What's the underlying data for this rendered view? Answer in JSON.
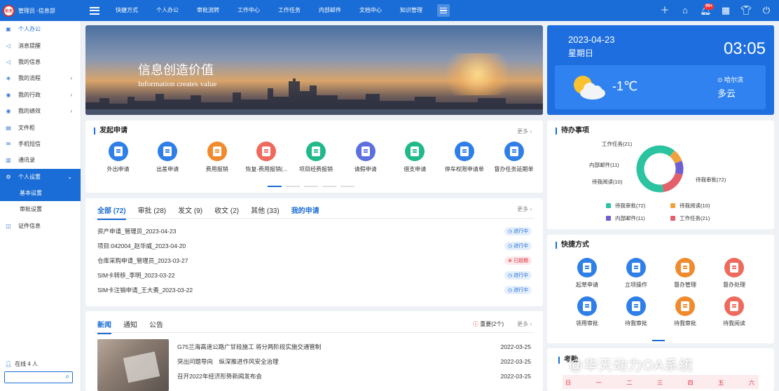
{
  "topbar": {
    "logo_text": "华天",
    "user": "管理员 -信息部",
    "nav": [
      "快捷方式",
      "个人办公",
      "审批流转",
      "工作中心",
      "工作任务",
      "内部邮件",
      "文档中心",
      "知识管理"
    ],
    "badge": "99+"
  },
  "sidebar": {
    "items": [
      {
        "label": "个人办公",
        "icon": "book-icon"
      },
      {
        "label": "消息提醒",
        "icon": "speaker-icon"
      },
      {
        "label": "我的信息",
        "icon": "speaker-icon"
      },
      {
        "label": "我的流程",
        "icon": "flow-icon",
        "chevron": "›"
      },
      {
        "label": "我的行政",
        "icon": "admin-icon",
        "chevron": "›"
      },
      {
        "label": "我的绩效",
        "icon": "performance-icon",
        "chevron": "›"
      },
      {
        "label": "文件柜",
        "icon": "cabinet-icon"
      },
      {
        "label": "手机短信",
        "icon": "mail-icon"
      },
      {
        "label": "通讯录",
        "icon": "contacts-icon"
      },
      {
        "label": "个人设置",
        "icon": "gear-icon",
        "chevron": "⌄"
      },
      {
        "label": "基本设置",
        "icon": ""
      },
      {
        "label": "审批设置",
        "icon": ""
      },
      {
        "label": "证件信息",
        "icon": "certificate-icon"
      }
    ],
    "online": "在线 4 人",
    "search_placeholder": ""
  },
  "banner": {
    "title": "信息创造价值",
    "subtitle": "Information creates value"
  },
  "weather": {
    "date": "2023-04-23",
    "weekday": "星期日",
    "time": "03:05",
    "temp": "-1℃",
    "city": "哈尔滨",
    "condition": "多云"
  },
  "apply": {
    "title": "发起申请",
    "more": "更多 ›",
    "apps": [
      {
        "label": "外出申请",
        "color": "#2f7fe8"
      },
      {
        "label": "出差申请",
        "color": "#2f7fe8"
      },
      {
        "label": "费用报销",
        "color": "#f08a2c"
      },
      {
        "label": "恢复-费用报销(...",
        "color": "#ee6a5c"
      },
      {
        "label": "项目经费报销",
        "color": "#20b98a"
      },
      {
        "label": "请假申请",
        "color": "#5d6fe0"
      },
      {
        "label": "借支申请",
        "color": "#20b98a"
      },
      {
        "label": "停车权限申请单",
        "color": "#2f7fe8"
      },
      {
        "label": "督办任务延期单",
        "color": "#2f7fe8"
      }
    ]
  },
  "requests": {
    "tabs": [
      "全部 (72)",
      "审批 (28)",
      "发文 (9)",
      "收文 (2)",
      "其他 (33)",
      "我的申请"
    ],
    "more": "更多 ›",
    "rows": [
      {
        "text": "资产申请_管理员_2023-04-23",
        "status": "进行中",
        "kind": "run"
      },
      {
        "text": "项目:042004_赵华威_2023-04-20",
        "status": "进行中",
        "kind": "run"
      },
      {
        "text": "仓库采购申请_管理员_2023-03-27",
        "status": "已超期",
        "kind": "late"
      },
      {
        "text": "SIM卡转移_李明_2023-03-22",
        "status": "进行中",
        "kind": "run"
      },
      {
        "text": "SIM卡注销申请_王大勇_2023-03-22",
        "status": "进行中",
        "kind": "run"
      }
    ]
  },
  "news": {
    "tabs": [
      "新闻",
      "通知",
      "公告"
    ],
    "important": "重要(2个)",
    "more": "更多 ›",
    "rows": [
      {
        "title": "G75兰海高速公路广甘段施工 将分两阶段实施交通管制",
        "date": "2022-03-25"
      },
      {
        "title": "突出问题导向　纵深推进作风安全治理",
        "date": "2022-03-25"
      },
      {
        "title": "召开2022年经济形势新闻发布会",
        "date": "2022-03-25"
      }
    ]
  },
  "todo": {
    "title": "待办事项",
    "legend": [
      {
        "label": "待我审批(72)",
        "color": "#2cc3a0"
      },
      {
        "label": "待我阅读(10)",
        "color": "#f0a23c"
      },
      {
        "label": "内部邮件(11)",
        "color": "#6d5fd1"
      },
      {
        "label": "工作任务(21)",
        "color": "#e4616c"
      }
    ],
    "donut_labels": [
      "工作任务(21)",
      "内部邮件(11)",
      "待我阅读(10)",
      "待我审批(72)"
    ]
  },
  "chart_data": {
    "type": "pie",
    "categories": [
      "待我审批",
      "待我阅读",
      "内部邮件",
      "工作任务"
    ],
    "values": [
      72,
      10,
      11,
      21
    ],
    "colors": [
      "#2cc3a0",
      "#f0a23c",
      "#6d5fd1",
      "#e4616c"
    ]
  },
  "quick": {
    "title": "快捷方式",
    "items": [
      {
        "label": "起草申请",
        "color": "#2f7fe8"
      },
      {
        "label": "立项操作",
        "color": "#2f7fe8"
      },
      {
        "label": "督办管理",
        "color": "#f08a2c"
      },
      {
        "label": "督办处理",
        "color": "#ee6a5c"
      },
      {
        "label": "领用审批",
        "color": "#2f7fe8"
      },
      {
        "label": "待我审批",
        "color": "#2f7fe8"
      },
      {
        "label": "待我审批",
        "color": "#f08a2c"
      },
      {
        "label": "待我阅读",
        "color": "#ee6a5c"
      }
    ]
  },
  "calendar": {
    "title": "考勤",
    "weekdays": [
      "日",
      "一",
      "二",
      "三",
      "四",
      "五",
      "六"
    ]
  },
  "watermark": "@华天动力OA系统"
}
